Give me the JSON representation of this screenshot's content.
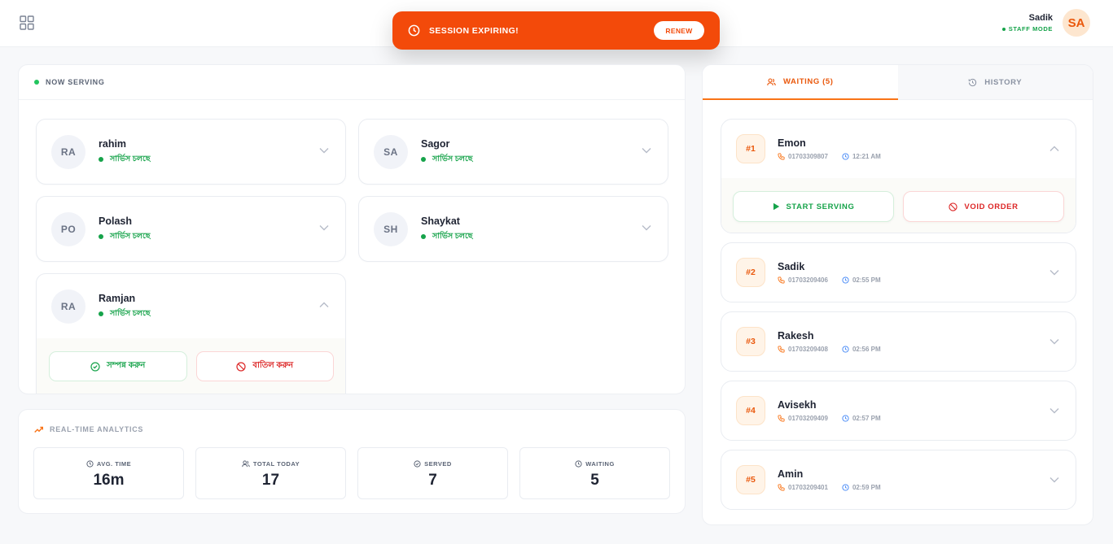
{
  "header": {
    "user_name": "Sadik",
    "user_mode": "STAFF MODE",
    "avatar_initials": "SA"
  },
  "toast": {
    "message": "SESSION EXPIRING!",
    "renew_label": "RENEW",
    "color": "#f34a0a"
  },
  "serving": {
    "title": "NOW SERVING",
    "customers": [
      {
        "initials": "RA",
        "name": "rahim",
        "status": "সার্ভিস চলছে"
      },
      {
        "initials": "SA",
        "name": "Sagor",
        "status": "সার্ভিস চলছে"
      },
      {
        "initials": "PO",
        "name": "Polash",
        "status": "সার্ভিস চলছে"
      },
      {
        "initials": "SH",
        "name": "Shaykat",
        "status": "সার্ভিস চলছে"
      },
      {
        "initials": "RA",
        "name": "Ramjan",
        "status": "সার্ভিস চলছে"
      }
    ],
    "complete_label": "সম্পন্ন করুন",
    "cancel_label": "বাতিল করুন"
  },
  "analytics": {
    "title": "REAL-TIME ANALYTICS",
    "stats": [
      {
        "label": "AVG. TIME",
        "value": "16m",
        "icon": "clock-icon"
      },
      {
        "label": "TOTAL TODAY",
        "value": "17",
        "icon": "users-icon"
      },
      {
        "label": "SERVED",
        "value": "7",
        "icon": "check-circle-icon"
      },
      {
        "label": "WAITING",
        "value": "5",
        "icon": "clock-icon"
      }
    ]
  },
  "queue": {
    "tab_waiting": "WAITING (5)",
    "tab_history": "HISTORY",
    "items": [
      {
        "num": "#1",
        "name": "Emon",
        "phone": "01703309807",
        "time": "12:21 AM"
      },
      {
        "num": "#2",
        "name": "Sadik",
        "phone": "01703209406",
        "time": "02:55 PM"
      },
      {
        "num": "#3",
        "name": "Rakesh",
        "phone": "01703209408",
        "time": "02:56 PM"
      },
      {
        "num": "#4",
        "name": "Avisekh",
        "phone": "01703209409",
        "time": "02:57 PM"
      },
      {
        "num": "#5",
        "name": "Amin",
        "phone": "01703209401",
        "time": "02:59 PM"
      }
    ],
    "start_label": "START SERVING",
    "void_label": "VOID ORDER"
  }
}
